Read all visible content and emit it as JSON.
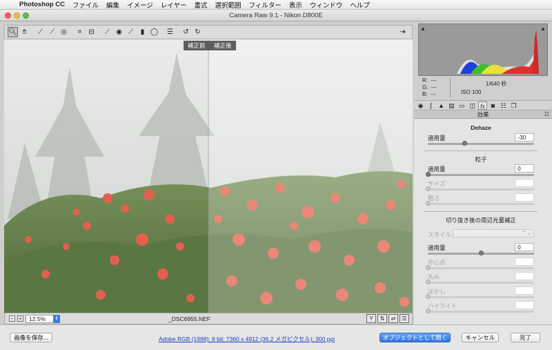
{
  "menubar": {
    "app": "Photoshop CC",
    "items": [
      "ファイル",
      "編集",
      "イメージ",
      "レイヤー",
      "書式",
      "選択範囲",
      "フィルター",
      "表示",
      "ウィンドウ",
      "ヘルプ"
    ]
  },
  "window": {
    "title": "Camera Raw 9.1  -  Nikon D800E"
  },
  "toolbar": {
    "tools": [
      "zoom-icon",
      "hand-icon",
      "white-balance-icon",
      "color-sampler-icon",
      "target-adjust-icon",
      "crop-icon",
      "straighten-icon",
      "spot-removal-icon",
      "red-eye-icon",
      "adjustment-brush-icon",
      "graduated-filter-icon",
      "radial-filter-icon",
      "preferences-icon",
      "rotate-ccw-icon",
      "rotate-cw-icon"
    ]
  },
  "preview": {
    "before_label": "補正前",
    "after_label": "補正後",
    "filename": "_DSC6955.NEF",
    "zoom": "12.5%"
  },
  "info": {
    "r_label": "R:",
    "r_value": "---",
    "g_label": "G:",
    "g_value": "---",
    "b_label": "B:",
    "b_value": "---",
    "shutter": "1/640 秒",
    "iso": "ISO 100"
  },
  "panel": {
    "title": "効果",
    "dehaze": {
      "heading": "Dehaze",
      "amount_label": "適用量",
      "amount_value": "-30",
      "amount": -30,
      "min": -100,
      "max": 100
    },
    "grain": {
      "heading": "粒子",
      "amount_label": "適用量",
      "amount_value": "0",
      "size_label": "サイズ",
      "roughness_label": "粗さ"
    },
    "vignette": {
      "heading": "切り抜き後の周辺光量補正",
      "style_label": "スタイル：",
      "amount_label": "適用量",
      "amount_value": "0",
      "midpoint_label": "中心点",
      "roundness_label": "丸み",
      "feather_label": "ぼかし",
      "highlights_label": "ハイライト"
    }
  },
  "bottom": {
    "save_label": "画像を保存...",
    "workflow": "Adobe RGB (1998); 8 bit; 7360 x 4912 (36.2 メガピクセル); 300 ppi",
    "open_object_label": "オブジェクトとして開く",
    "cancel_label": "キャンセル",
    "done_label": "完了"
  },
  "colors": {
    "primary_button": "#2f74e0",
    "histogram_bg": "#9a9a9a",
    "flower": "#e2533f"
  }
}
